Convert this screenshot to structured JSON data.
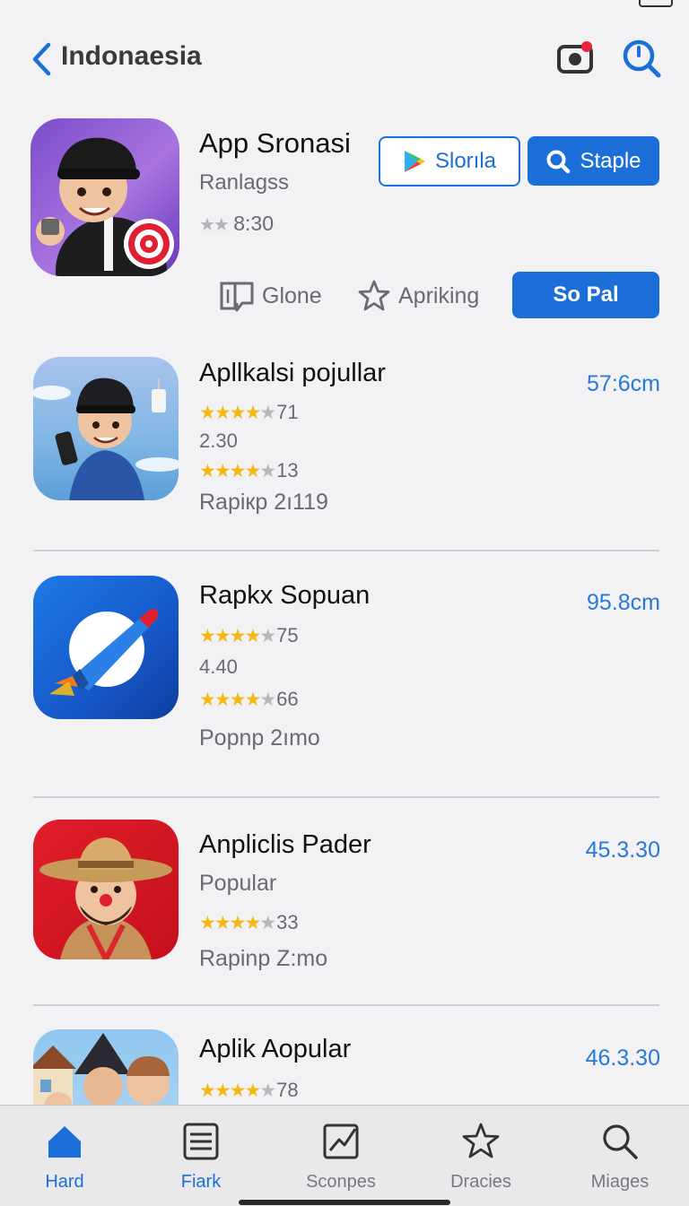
{
  "header": {
    "title": "Indonaesia"
  },
  "featured": {
    "title": "App Sronasi",
    "subtitle": "Ranlagss",
    "rating": "8:30",
    "buttons": {
      "store": "Slorıla",
      "staple": "Staple"
    },
    "actions": {
      "clone": "Glone",
      "apriking": "Apriking",
      "so_pal": "So Pal"
    }
  },
  "apps": [
    {
      "name": "Apllkalsi poјullar",
      "size": "57:6cm",
      "rating1": "71",
      "meta": "2.30",
      "rating2": "13",
      "footer": "Rapiкp 2ı119"
    },
    {
      "name": "Rapkx Sopuan",
      "size": "95.8cm",
      "rating1": "75",
      "meta": "4.40",
      "rating2": "66",
      "footer": "Popnp 2ımo"
    },
    {
      "name": "Anpliclis Pader",
      "size": "45.3.30",
      "subtitle": "Popular",
      "rating": "33",
      "footer": "Rapinp Z:mo"
    },
    {
      "name": "Aplik Aopular",
      "size": "46.3.30",
      "rating": "78"
    }
  ],
  "tabs": [
    {
      "label": "Hard",
      "icon": "house-icon",
      "active": true
    },
    {
      "label": "Fiark",
      "icon": "list-icon",
      "active": true
    },
    {
      "label": "Sconpes",
      "icon": "chart-square-icon",
      "active": false
    },
    {
      "label": "Dracies",
      "icon": "star-outline-icon",
      "active": false
    },
    {
      "label": "Miages",
      "icon": "search-icon",
      "active": false
    }
  ],
  "colors": {
    "accent": "#1c6fd9",
    "star": "#f2b817",
    "size_text": "#2979d6"
  }
}
